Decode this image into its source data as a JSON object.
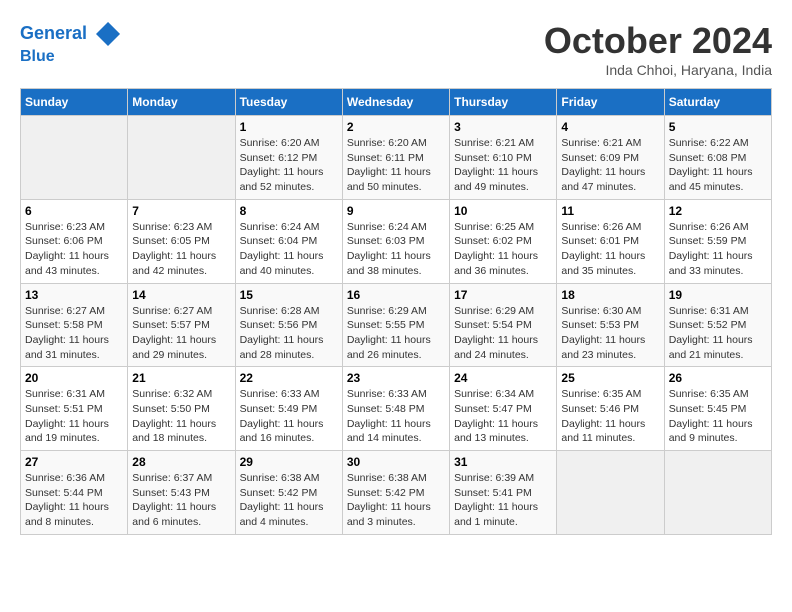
{
  "header": {
    "logo_line1": "General",
    "logo_line2": "Blue",
    "month": "October 2024",
    "location": "Inda Chhoi, Haryana, India"
  },
  "days_of_week": [
    "Sunday",
    "Monday",
    "Tuesday",
    "Wednesday",
    "Thursday",
    "Friday",
    "Saturday"
  ],
  "weeks": [
    [
      {
        "day": "",
        "info": ""
      },
      {
        "day": "",
        "info": ""
      },
      {
        "day": "1",
        "info": "Sunrise: 6:20 AM\nSunset: 6:12 PM\nDaylight: 11 hours and 52 minutes."
      },
      {
        "day": "2",
        "info": "Sunrise: 6:20 AM\nSunset: 6:11 PM\nDaylight: 11 hours and 50 minutes."
      },
      {
        "day": "3",
        "info": "Sunrise: 6:21 AM\nSunset: 6:10 PM\nDaylight: 11 hours and 49 minutes."
      },
      {
        "day": "4",
        "info": "Sunrise: 6:21 AM\nSunset: 6:09 PM\nDaylight: 11 hours and 47 minutes."
      },
      {
        "day": "5",
        "info": "Sunrise: 6:22 AM\nSunset: 6:08 PM\nDaylight: 11 hours and 45 minutes."
      }
    ],
    [
      {
        "day": "6",
        "info": "Sunrise: 6:23 AM\nSunset: 6:06 PM\nDaylight: 11 hours and 43 minutes."
      },
      {
        "day": "7",
        "info": "Sunrise: 6:23 AM\nSunset: 6:05 PM\nDaylight: 11 hours and 42 minutes."
      },
      {
        "day": "8",
        "info": "Sunrise: 6:24 AM\nSunset: 6:04 PM\nDaylight: 11 hours and 40 minutes."
      },
      {
        "day": "9",
        "info": "Sunrise: 6:24 AM\nSunset: 6:03 PM\nDaylight: 11 hours and 38 minutes."
      },
      {
        "day": "10",
        "info": "Sunrise: 6:25 AM\nSunset: 6:02 PM\nDaylight: 11 hours and 36 minutes."
      },
      {
        "day": "11",
        "info": "Sunrise: 6:26 AM\nSunset: 6:01 PM\nDaylight: 11 hours and 35 minutes."
      },
      {
        "day": "12",
        "info": "Sunrise: 6:26 AM\nSunset: 5:59 PM\nDaylight: 11 hours and 33 minutes."
      }
    ],
    [
      {
        "day": "13",
        "info": "Sunrise: 6:27 AM\nSunset: 5:58 PM\nDaylight: 11 hours and 31 minutes."
      },
      {
        "day": "14",
        "info": "Sunrise: 6:27 AM\nSunset: 5:57 PM\nDaylight: 11 hours and 29 minutes."
      },
      {
        "day": "15",
        "info": "Sunrise: 6:28 AM\nSunset: 5:56 PM\nDaylight: 11 hours and 28 minutes."
      },
      {
        "day": "16",
        "info": "Sunrise: 6:29 AM\nSunset: 5:55 PM\nDaylight: 11 hours and 26 minutes."
      },
      {
        "day": "17",
        "info": "Sunrise: 6:29 AM\nSunset: 5:54 PM\nDaylight: 11 hours and 24 minutes."
      },
      {
        "day": "18",
        "info": "Sunrise: 6:30 AM\nSunset: 5:53 PM\nDaylight: 11 hours and 23 minutes."
      },
      {
        "day": "19",
        "info": "Sunrise: 6:31 AM\nSunset: 5:52 PM\nDaylight: 11 hours and 21 minutes."
      }
    ],
    [
      {
        "day": "20",
        "info": "Sunrise: 6:31 AM\nSunset: 5:51 PM\nDaylight: 11 hours and 19 minutes."
      },
      {
        "day": "21",
        "info": "Sunrise: 6:32 AM\nSunset: 5:50 PM\nDaylight: 11 hours and 18 minutes."
      },
      {
        "day": "22",
        "info": "Sunrise: 6:33 AM\nSunset: 5:49 PM\nDaylight: 11 hours and 16 minutes."
      },
      {
        "day": "23",
        "info": "Sunrise: 6:33 AM\nSunset: 5:48 PM\nDaylight: 11 hours and 14 minutes."
      },
      {
        "day": "24",
        "info": "Sunrise: 6:34 AM\nSunset: 5:47 PM\nDaylight: 11 hours and 13 minutes."
      },
      {
        "day": "25",
        "info": "Sunrise: 6:35 AM\nSunset: 5:46 PM\nDaylight: 11 hours and 11 minutes."
      },
      {
        "day": "26",
        "info": "Sunrise: 6:35 AM\nSunset: 5:45 PM\nDaylight: 11 hours and 9 minutes."
      }
    ],
    [
      {
        "day": "27",
        "info": "Sunrise: 6:36 AM\nSunset: 5:44 PM\nDaylight: 11 hours and 8 minutes."
      },
      {
        "day": "28",
        "info": "Sunrise: 6:37 AM\nSunset: 5:43 PM\nDaylight: 11 hours and 6 minutes."
      },
      {
        "day": "29",
        "info": "Sunrise: 6:38 AM\nSunset: 5:42 PM\nDaylight: 11 hours and 4 minutes."
      },
      {
        "day": "30",
        "info": "Sunrise: 6:38 AM\nSunset: 5:42 PM\nDaylight: 11 hours and 3 minutes."
      },
      {
        "day": "31",
        "info": "Sunrise: 6:39 AM\nSunset: 5:41 PM\nDaylight: 11 hours and 1 minute."
      },
      {
        "day": "",
        "info": ""
      },
      {
        "day": "",
        "info": ""
      }
    ]
  ]
}
